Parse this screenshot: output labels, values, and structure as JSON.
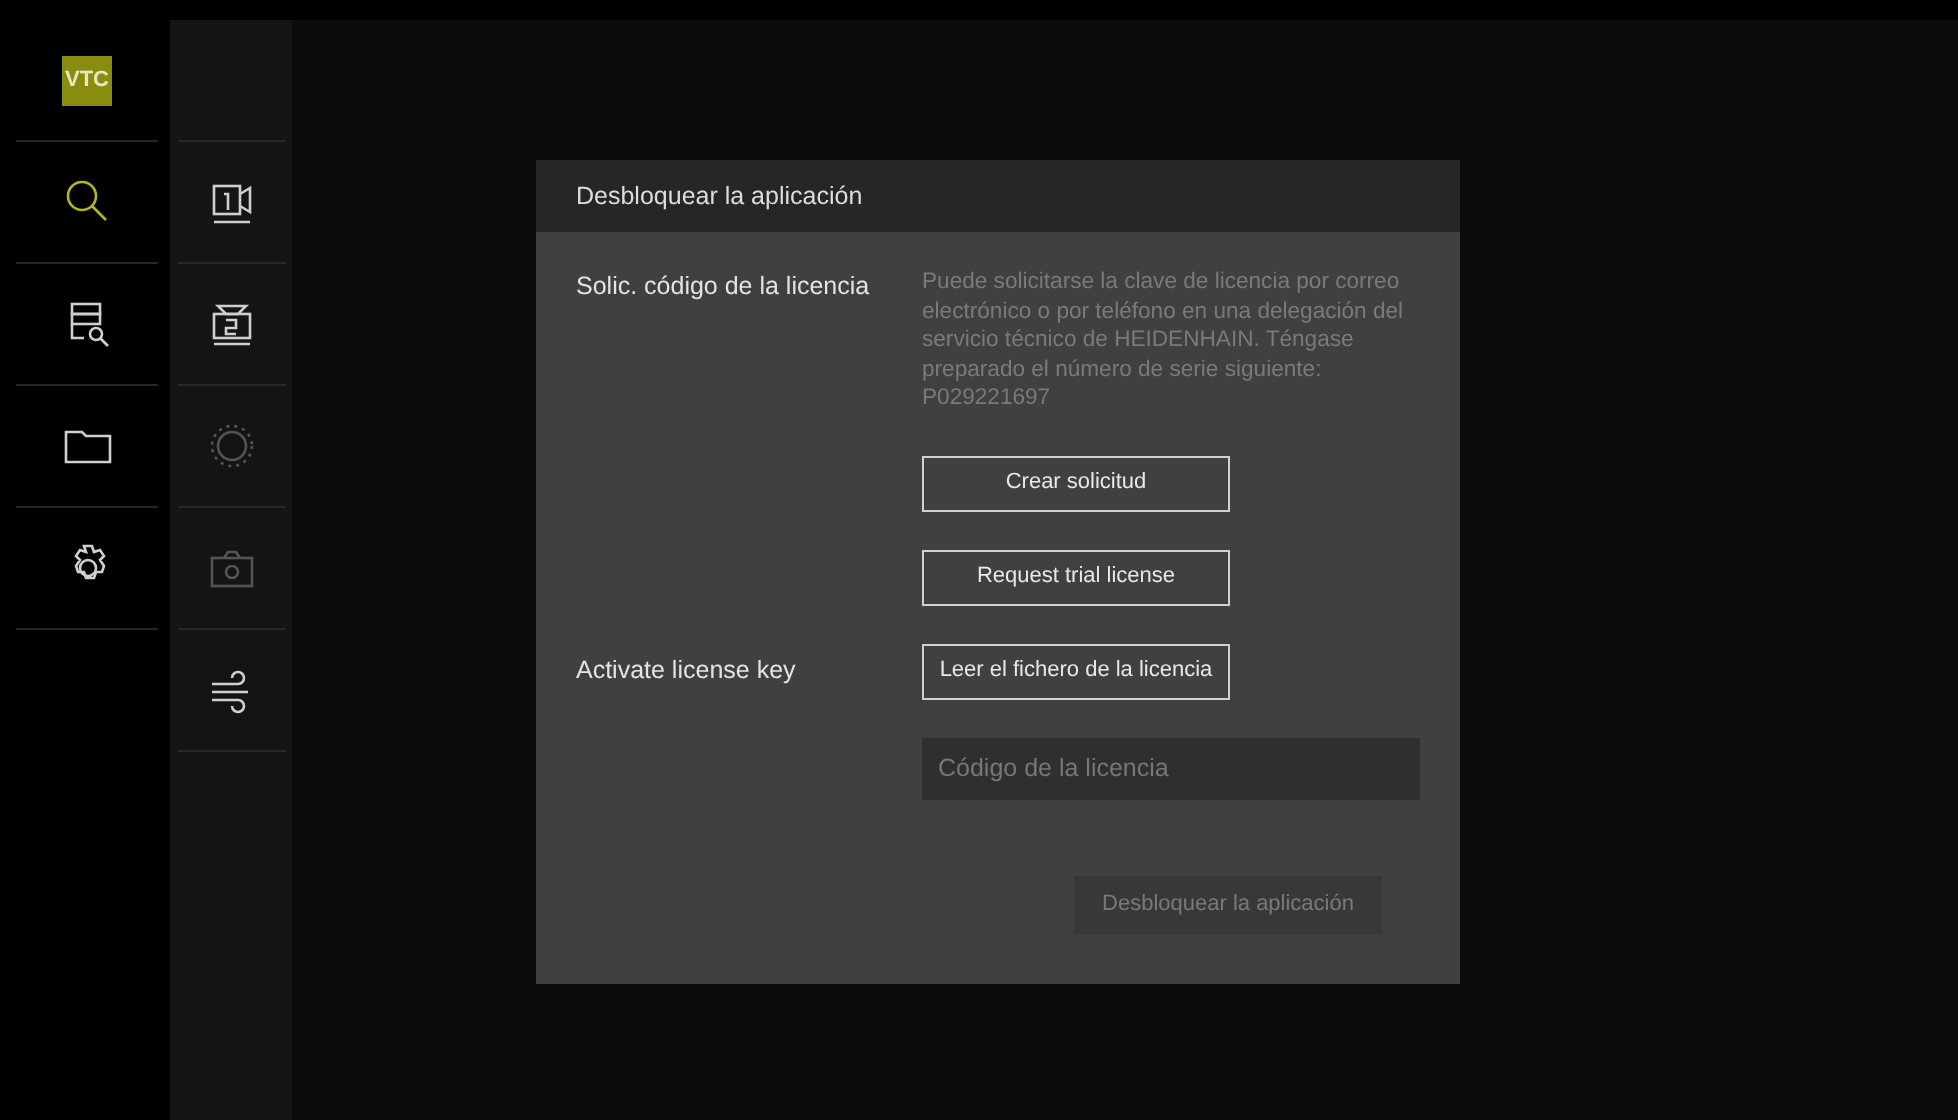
{
  "logo": "VTC",
  "sidebar": {
    "items": [
      {
        "kind": "search",
        "selected": true
      },
      {
        "kind": "list",
        "selected": false
      },
      {
        "kind": "folder",
        "selected": false
      },
      {
        "kind": "gear",
        "selected": false
      }
    ]
  },
  "toolbar": {
    "items": [
      {
        "kind": "cam1",
        "disabled": false
      },
      {
        "kind": "cam2",
        "disabled": false
      },
      {
        "kind": "sun",
        "disabled": true
      },
      {
        "kind": "camera",
        "disabled": true
      },
      {
        "kind": "wind",
        "disabled": false
      }
    ]
  },
  "dialog": {
    "title": "Desbloquear la aplicación",
    "request": {
      "label": "Solic. código de la licencia",
      "info": "Puede solicitarse la clave de licencia por correo electrónico o por teléfono en una delegación del servicio técnico de HEIDENHAIN. Téngase preparado el número de serie siguiente: P029221697",
      "buttons": [
        "Crear solicitud",
        "Request trial license"
      ]
    },
    "activate": {
      "label": "Activate license key",
      "button": "Leer el fichero de la licencia",
      "field": {
        "placeholder": "Código de la licencia"
      }
    },
    "unlock_button": {
      "label": "Desbloquear la aplicación",
      "disabled": true
    }
  }
}
